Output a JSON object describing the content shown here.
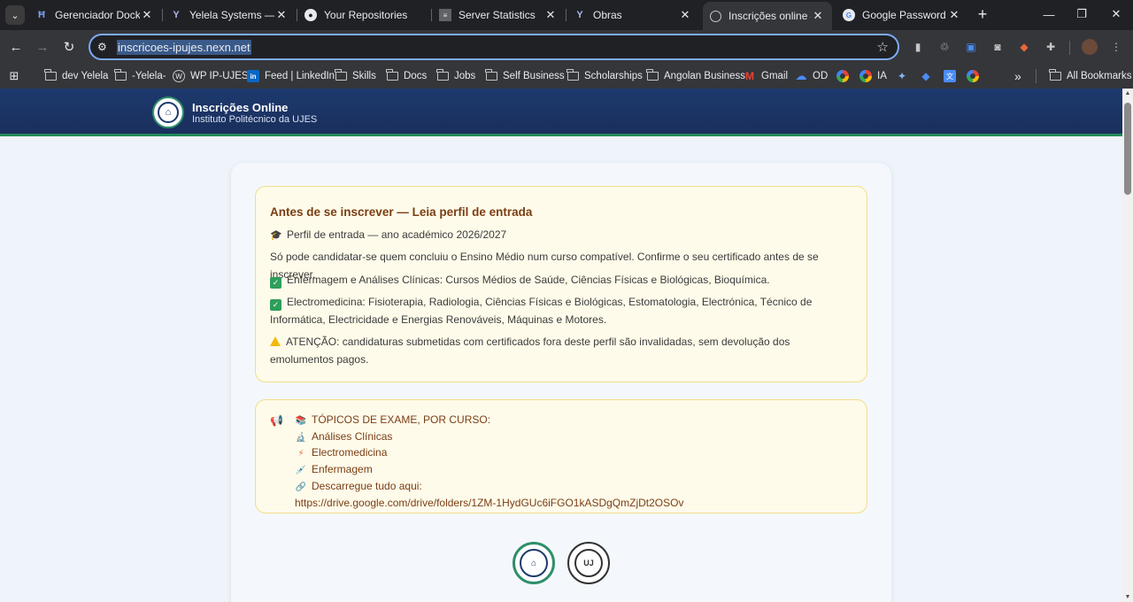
{
  "browser": {
    "tabs": [
      {
        "title": "Gerenciador Docker |",
        "favicon": "docker-icon"
      },
      {
        "title": "Yelela Systems — sof",
        "favicon": "yelela-icon"
      },
      {
        "title": "Your Repositories",
        "favicon": "github-icon"
      },
      {
        "title": "Server Statistics",
        "favicon": "stats-icon"
      },
      {
        "title": "Obras",
        "favicon": "yelela-icon"
      },
      {
        "title": "Inscrições online — I",
        "favicon": "globe-icon",
        "active": true
      },
      {
        "title": "Google Password Ma",
        "favicon": "google-password-icon"
      }
    ],
    "url": "inscricoes-ipujes.nexn.net",
    "bookmarks": [
      {
        "label": "dev Yelela",
        "icon": "folder-icon"
      },
      {
        "label": "-Yelela-",
        "icon": "folder-icon"
      },
      {
        "label": "WP IP-UJES",
        "icon": "wordpress-icon"
      },
      {
        "label": "Feed | LinkedIn",
        "icon": "linkedin-icon"
      },
      {
        "label": "Skills",
        "icon": "folder-icon"
      },
      {
        "label": "Docs",
        "icon": "folder-icon"
      },
      {
        "label": "Jobs",
        "icon": "folder-icon"
      },
      {
        "label": "Self Business",
        "icon": "folder-icon"
      },
      {
        "label": "Scholarships",
        "icon": "folder-icon"
      },
      {
        "label": "Angolan Business",
        "icon": "folder-icon"
      },
      {
        "label": "Gmail",
        "icon": "gmail-icon"
      },
      {
        "label": "OD",
        "icon": "onedrive-icon"
      },
      {
        "label": "IA",
        "icon": "google-icon"
      }
    ],
    "all_bookmarks_label": "All Bookmarks",
    "more_bookmarks_glyph": "»"
  },
  "page": {
    "header": {
      "title": "Inscrições Online",
      "subtitle": "Instituto Politécnico da UJES"
    },
    "notice_profile": {
      "title": "Antes de se inscrever — Leia perfil de entrada",
      "profile_line": "Perfil de entrada — ano académico 2026/2027",
      "requirement": "Só pode candidatar-se quem concluiu o Ensino Médio num curso compatível. Confirme o seu certificado antes de se inscrever.",
      "course1": "Enfermagem e Análises Clínicas: Cursos Médios de Saúde, Ciências Físicas e Biológicas, Bioquímica.",
      "course2": "Electromedicina: Fisioterapia, Radiologia, Ciências Físicas e Biológicas, Estomatologia, Electrónica, Técnico de Informática, Electricidade e Energias Renováveis, Máquinas e Motores.",
      "warning": "ATENÇÃO: candidaturas submetidas com certificados fora deste perfil são invalidadas, sem devolução dos emolumentos pagos."
    },
    "notice_topics": {
      "heading": "TÓPICOS DE EXAME, POR CURSO:",
      "items": [
        "Análises Clínicas",
        "Electromedicina",
        "Enfermagem"
      ],
      "download_label": "Descarregue tudo aqui:",
      "download_link": "https://drive.google.com/drive/folders/1ZM-1HydGUc6iFGO1kASDgQmZjDt2OSOv"
    }
  },
  "colors": {
    "header_bg": "#1d3a6e",
    "accent_green": "#1f8a5a",
    "notice_bg": "#fffbea",
    "notice_border": "#f2dd8a",
    "notice_title": "#7a3e14"
  }
}
